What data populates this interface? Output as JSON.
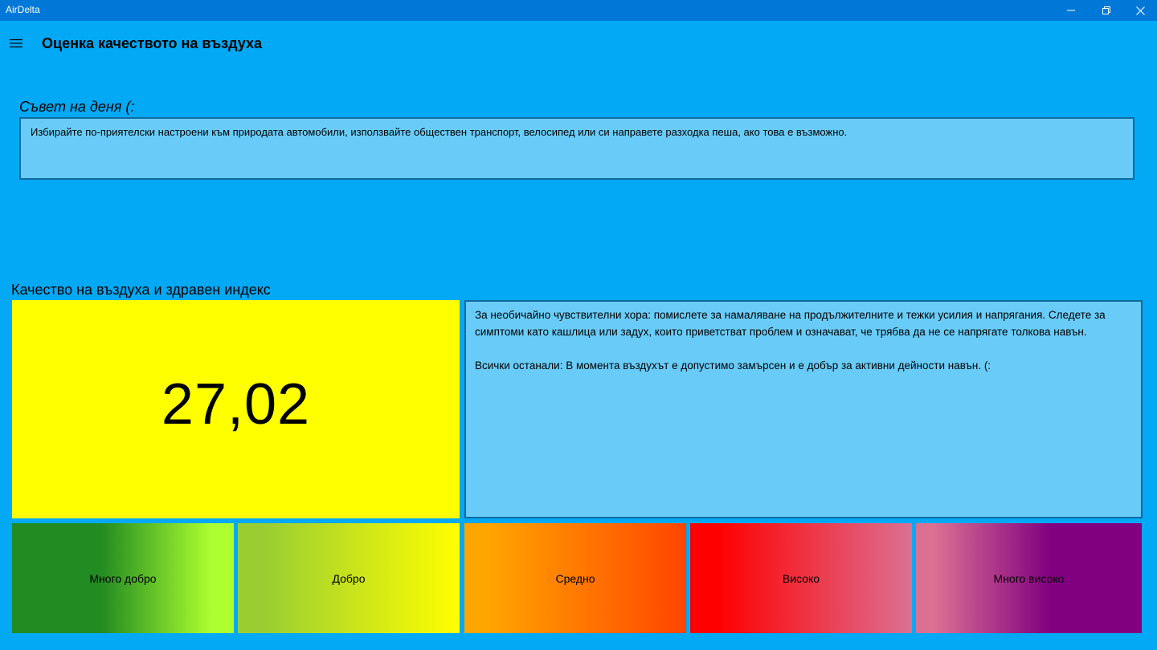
{
  "window": {
    "title": "AirDelta",
    "controls": {
      "minimize": "minimize",
      "maximize": "restore",
      "close": "close"
    }
  },
  "header": {
    "title": "Оценка качеството на въздуха"
  },
  "tip": {
    "label": "Съвет на деня (:",
    "text": "Избирайте по-приятелски настроени към природата автомобили, използвайте обществен транспорт, велосипед или си направете разходка пеша, ако това е възможно."
  },
  "aqi": {
    "label": "Качество на въздуха и здравен индекс",
    "value": "27,02",
    "tile_color": "#ffff00",
    "advice": [
      "За необичайно чувствителни хора: помислете за намаляване на продължителните и тежки усилия и напрягания. Следете за симптоми като кашлица или задух, които приветстват проблем и означават, че трябва да не се напрягате толкова навън.",
      "Всички останали: В момента въздухът е допустимо замърсен и е добър за активни дейности навън. (:"
    ]
  },
  "scale": [
    {
      "label": "Много добро",
      "colors": [
        "#228b22",
        "#adff2f"
      ]
    },
    {
      "label": "Добро",
      "colors": [
        "#9acd32",
        "#ffff00"
      ]
    },
    {
      "label": "Средно",
      "colors": [
        "#ffa500",
        "#ff4500"
      ]
    },
    {
      "label": "Високо",
      "colors": [
        "#ff0000",
        "#db7093"
      ]
    },
    {
      "label": "Много високо",
      "colors": [
        "#db7093",
        "#800080"
      ]
    }
  ],
  "colors": {
    "background": "#03a9f4",
    "titlebar": "#0078d7",
    "panel": "#69ccf8",
    "panel_border": "#0f6a9e"
  },
  "icons": {
    "menu": "hamburger-icon",
    "minimize": "minimize-icon",
    "maximize": "restore-icon",
    "close": "close-icon"
  }
}
